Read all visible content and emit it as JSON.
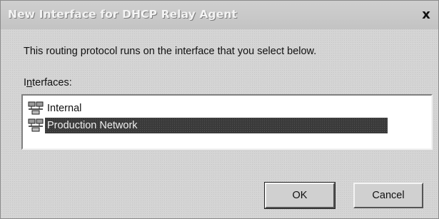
{
  "dialog": {
    "title": "New Interface for DHCP Relay Agent",
    "close_label": "x",
    "description": "This routing protocol runs on the interface that you select below."
  },
  "interfaces": {
    "label_prefix": "I",
    "label_accesskey": "n",
    "label_suffix": "terfaces:",
    "items": [
      {
        "label": "Internal",
        "icon": "network-interface-icon",
        "selected": false
      },
      {
        "label": "Production Network",
        "icon": "network-interface-icon",
        "selected": true
      }
    ]
  },
  "buttons": {
    "ok": "OK",
    "cancel": "Cancel"
  }
}
